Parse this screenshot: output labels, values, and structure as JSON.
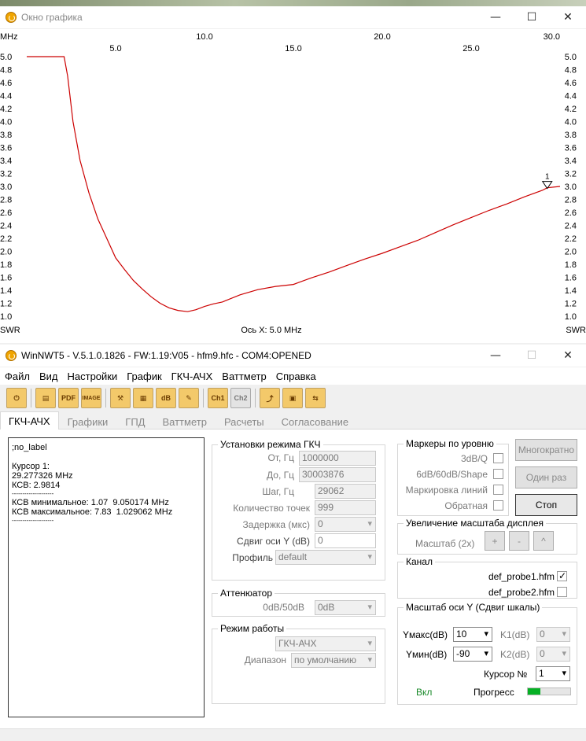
{
  "graph_window": {
    "title": "Окно графика",
    "x_unit": "MHz",
    "y_label_left": "SWR",
    "y_label_right": "SWR",
    "x_axis_caption": "Ось X: 5.0 MHz",
    "marker_label": "1"
  },
  "chart_data": {
    "type": "line",
    "xlim": [
      0.0,
      30.0
    ],
    "ylim": [
      1.0,
      5.0
    ],
    "x_ticks_top": [
      "10.0",
      "20.0",
      "30.0"
    ],
    "x_ticks_top_values": [
      10,
      20,
      30
    ],
    "x_ticks_bottom": [
      "5.0",
      "15.0",
      "25.0"
    ],
    "x_ticks_bottom_values": [
      5,
      15,
      25
    ],
    "y_ticks": [
      "5.0",
      "4.8",
      "4.6",
      "4.4",
      "4.2",
      "4.0",
      "3.8",
      "3.6",
      "3.4",
      "3.2",
      "3.0",
      "2.8",
      "2.6",
      "2.4",
      "2.2",
      "2.0",
      "1.8",
      "1.6",
      "1.4",
      "1.2",
      "1.0"
    ],
    "y_tick_values": [
      5.0,
      4.8,
      4.6,
      4.4,
      4.2,
      4.0,
      3.8,
      3.6,
      3.4,
      3.2,
      3.0,
      2.8,
      2.6,
      2.4,
      2.2,
      2.0,
      1.8,
      1.6,
      1.4,
      1.2,
      1.0
    ],
    "grid": false,
    "series": [
      {
        "color": "#cc0000",
        "x": [
          1.03,
          2.1,
          2.3,
          2.6,
          3.0,
          3.5,
          4.0,
          4.5,
          5.0,
          5.5,
          6.0,
          6.5,
          7.0,
          7.5,
          8.0,
          8.5,
          9.05,
          9.5,
          10.0,
          10.5,
          11.0,
          12.0,
          13.0,
          14.0,
          15.0,
          16.0,
          17.0,
          18.0,
          19.0,
          20.0,
          21.0,
          22.0,
          23.0,
          24.0,
          25.0,
          26.0,
          27.0,
          28.0,
          29.0,
          29.28,
          30.0
        ],
        "y": [
          5.0,
          5.0,
          4.7,
          4.0,
          3.4,
          2.9,
          2.5,
          2.2,
          1.9,
          1.72,
          1.55,
          1.42,
          1.3,
          1.2,
          1.13,
          1.09,
          1.07,
          1.1,
          1.15,
          1.19,
          1.22,
          1.33,
          1.41,
          1.46,
          1.49,
          1.59,
          1.68,
          1.78,
          1.88,
          1.97,
          2.07,
          2.17,
          2.29,
          2.41,
          2.52,
          2.63,
          2.73,
          2.84,
          2.94,
          2.98,
          3.0
        ]
      }
    ]
  },
  "main_window": {
    "title": "WinNWT5 - V.5.1.0.1826 - FW:1.19:V05 - hfm9.hfc - COM4:OPENED",
    "menu": [
      "Файл",
      "Вид",
      "Настройки",
      "График",
      "ГКЧ-АЧХ",
      "Ваттметр",
      "Справка"
    ],
    "toolbar": [
      "power-icon",
      "print-icon",
      "pdf-icon",
      "image-icon",
      "tools-icon",
      "calibrate-icon",
      "db-icon",
      "probe-icon",
      "ch1-icon",
      "ch2-icon",
      "sweep-icon",
      "save-icon",
      "swap-icon"
    ],
    "toolbar_texts": {
      "pdf": "PDF",
      "image": "IMAGE",
      "db": "dB",
      "ch1": "Ch1",
      "ch2": "Ch2"
    },
    "tabs": [
      "ГКЧ-АЧХ",
      "Графики",
      "ГПД",
      "Ваттметр",
      "Расчеты",
      "Согласование"
    ],
    "active_tab": 0
  },
  "log": [
    ";no_label",
    "",
    "Курсор 1:",
    "29.277326 MHz",
    "КСВ: 2.9814",
    "--------------------",
    "КСВ минимальное: 1.07  9.050174 MHz",
    "КСВ максимальное: 7.83  1.029062 MHz",
    "--------------------"
  ],
  "sweep_settings": {
    "title": "Установки режима ГКЧ",
    "from_label": "От, Гц",
    "from_value": "1000000",
    "to_label": "До, Гц",
    "to_value": "30003876",
    "step_label": "Шаг, Гц",
    "step_value": "29062",
    "points_label": "Количество точек",
    "points_value": "999",
    "delay_label": "Задержка (мкс)",
    "delay_value": "0",
    "yshift_label": "Сдвиг оси Y (dB)",
    "yshift_value": "0",
    "profile_label": "Профиль",
    "profile_value": "default"
  },
  "attenuator": {
    "title": "Аттенюатор",
    "label": "0dB/50dB",
    "value": "0dB"
  },
  "mode": {
    "title": "Режим работы",
    "value": "ГКЧ-АЧХ",
    "range_label": "Диапазон",
    "range_value": "по умолчанию"
  },
  "markers": {
    "title": "Маркеры по уровню",
    "items": [
      "3dB/Q",
      "6dB/60dB/Shape",
      "Маркировка линий",
      "Обратная"
    ]
  },
  "buttons": {
    "multi": "Многократно",
    "once": "Один раз",
    "stop": "Стоп"
  },
  "zoom": {
    "title": "Увеличение масштаба дисплея",
    "label": "Масштаб (2x)",
    "plus": "+",
    "minus": "-",
    "caret": "^"
  },
  "channel": {
    "title": "Канал",
    "probe1": "def_probe1.hfm",
    "probe1_checked": true,
    "probe2": "def_probe2.hfm",
    "probe2_checked": false
  },
  "yscale": {
    "title": "Масштаб оси Y (Сдвиг шкалы)",
    "ymax_label": "Yмакс(dB)",
    "ymax_value": "10",
    "ymin_label": "Yмин(dB)",
    "ymin_value": "-90",
    "k1_label": "K1(dB)",
    "k1_value": "0",
    "k2_label": "K2(dB)",
    "k2_value": "0",
    "cursor_label": "Курсор №",
    "cursor_value": "1",
    "on_label": "Вкл",
    "progress_label": "Прогресс",
    "progress": 0.3
  }
}
